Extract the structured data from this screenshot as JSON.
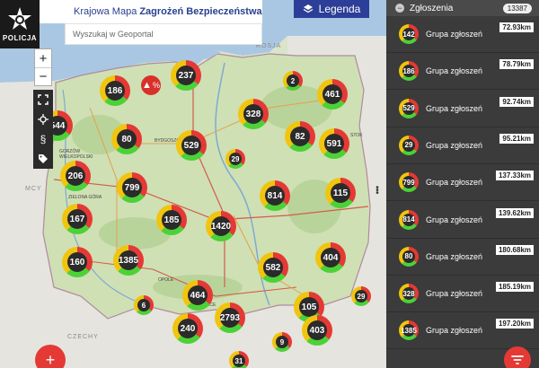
{
  "header": {
    "logo_text": "POLICJA",
    "title_regular": "Krajowa Mapa",
    "title_bold": "Zagrożeń Bezpieczeństwa",
    "legend_label": "Legenda"
  },
  "search": {
    "placeholder": "Wyszukaj w Geoportal"
  },
  "map": {
    "country_labels": {
      "russia": "ROSJA",
      "czech": "CZECHY",
      "germany": "MCY"
    },
    "city_labels": {
      "gorzow": "GORZÓW WIELKOPOLSKI",
      "zielona": "ZIELONA GÓRA",
      "bydgoszcz": "BYDGOSZCZ",
      "opole": "OPOLE",
      "kielce": "KCE",
      "bialystok": "STOK"
    },
    "poi_symbol": "%",
    "clusters": [
      "186",
      "237",
      "2",
      "461",
      "544",
      "80",
      "328",
      "82",
      "591",
      "529",
      "29",
      "206",
      "799",
      "814",
      "115",
      "167",
      "185",
      "1420",
      "160",
      "1385",
      "582",
      "404",
      "464",
      "6",
      "2793",
      "105",
      "29",
      "240",
      "403",
      "9",
      "31"
    ],
    "zoom_in": "+",
    "zoom_out": "−",
    "add_symbol": "+"
  },
  "panel": {
    "title": "Zgłoszenia",
    "count": "13387",
    "rows": [
      {
        "count": "142",
        "label": "Grupa zgłoszeń",
        "distance": "72.93km"
      },
      {
        "count": "186",
        "label": "Grupa zgłoszeń",
        "distance": "78.79km"
      },
      {
        "count": "529",
        "label": "Grupa zgłoszeń",
        "distance": "92.74km"
      },
      {
        "count": "29",
        "label": "Grupa zgłoszeń",
        "distance": "95.21km"
      },
      {
        "count": "799",
        "label": "Grupa zgłoszeń",
        "distance": "137.33km"
      },
      {
        "count": "814",
        "label": "Grupa zgłoszeń",
        "distance": "139.62km"
      },
      {
        "count": "80",
        "label": "Grupa zgłoszeń",
        "distance": "180.68km"
      },
      {
        "count": "328",
        "label": "Grupa zgłoszeń",
        "distance": "185.19km"
      },
      {
        "count": "1385",
        "label": "Grupa zgłoszeń",
        "distance": "197.20km"
      }
    ]
  },
  "colors": {
    "accent_blue": "#2c3e97",
    "accent_red": "#e53935",
    "panel_bg": "#3b3b3b"
  }
}
